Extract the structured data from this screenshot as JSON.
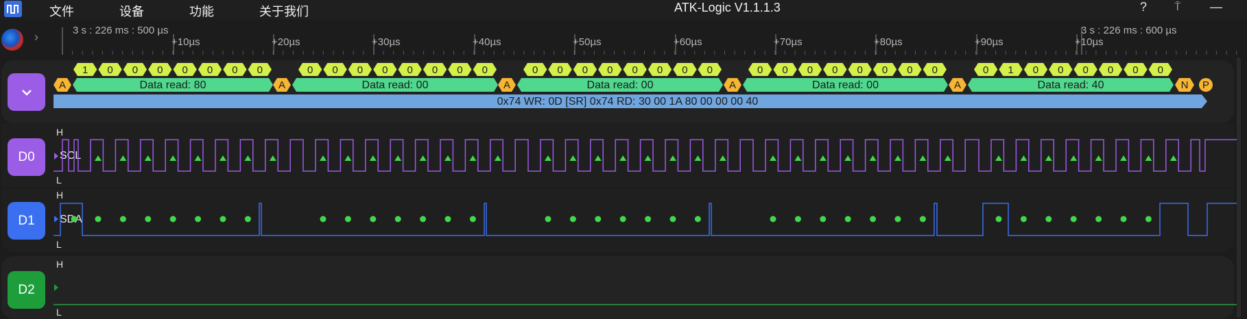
{
  "app": {
    "title": "ATK-Logic  V1.1.1.3"
  },
  "menu": [
    "文件",
    "设备",
    "功能",
    "关于我们"
  ],
  "window_buttons": {
    "help": "?",
    "pin": "⍑",
    "minimize": "—"
  },
  "ruler": {
    "start_label": "3 s : 226 ms : 500 µs",
    "end_label": "3 s : 226 ms : 600 µs",
    "ticks": [
      "+10µs",
      "+20µs",
      "+30µs",
      "+40µs",
      "+50µs",
      "+60µs",
      "+70µs",
      "+80µs",
      "+90µs",
      "+10µs"
    ]
  },
  "decoder": {
    "channel_icon": "chevron-down-icon",
    "bits_groups": [
      [
        "1",
        "0",
        "0",
        "0",
        "0",
        "0",
        "0",
        "0"
      ],
      [
        "0",
        "0",
        "0",
        "0",
        "0",
        "0",
        "0",
        "0"
      ],
      [
        "0",
        "0",
        "0",
        "0",
        "0",
        "0",
        "0",
        "0"
      ],
      [
        "0",
        "0",
        "0",
        "0",
        "0",
        "0",
        "0",
        "0"
      ],
      [
        "0",
        "1",
        "0",
        "0",
        "0",
        "0",
        "0",
        "0"
      ]
    ],
    "acks": [
      "A",
      "A",
      "A",
      "A",
      "A"
    ],
    "data_labels": [
      "Data read: 80",
      "Data read: 00",
      "Data read: 00",
      "Data read: 00",
      "Data read: 40"
    ],
    "nack": "N",
    "stop": "P",
    "summary": "0x74 WR: 0D [SR] 0x74 RD: 30 00 1A 80 00 00 00 40"
  },
  "channels": [
    {
      "id": "D0",
      "name": "SCL",
      "high": "H",
      "low": "L",
      "color": "#9b5ce6"
    },
    {
      "id": "D1",
      "name": "SDA",
      "high": "H",
      "low": "L",
      "color": "#3a6ff0"
    },
    {
      "id": "D2",
      "name": "",
      "high": "H",
      "low": "L",
      "color": "#1e9e3a"
    }
  ],
  "colors": {
    "bits": "#d4f04a",
    "ack": "#f6b533",
    "data": "#4fd88e",
    "summary": "#6fa6e0",
    "scl_wave": "#9b5ce6",
    "sda_wave": "#3a6ff0",
    "d2_wave": "#2e9e3e",
    "marker": "#3fd94a"
  }
}
